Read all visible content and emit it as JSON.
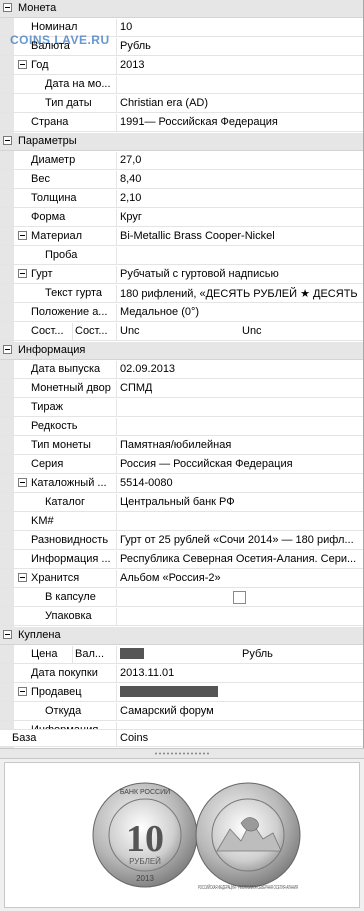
{
  "watermark": "COINS LAVE.RU",
  "categories": {
    "c1": "Монета",
    "c2": "Параметры",
    "c3": "Информация",
    "c4": "Куплена"
  },
  "rows": {
    "nominal": {
      "label": "Номинал",
      "value": "10"
    },
    "currency": {
      "label": "Валюта",
      "value": "Рубль"
    },
    "year": {
      "label": "Год",
      "value": "2013"
    },
    "date_mo": {
      "label": "Дата на мо...",
      "value": ""
    },
    "date_type": {
      "label": "Тип даты",
      "value": "Christian era (AD)"
    },
    "country": {
      "label": "Страна",
      "value": "1991— Российская Федерация"
    },
    "diameter": {
      "label": "Диаметр",
      "value": "27,0"
    },
    "weight": {
      "label": "Вес",
      "value": "8,40"
    },
    "thickness": {
      "label": "Толщина",
      "value": "2,10"
    },
    "shape": {
      "label": "Форма",
      "value": "Круг"
    },
    "material": {
      "label": "Материал",
      "value": "Bi-Metallic Brass Cooper-Nickel"
    },
    "proba": {
      "label": "Проба",
      "value": ""
    },
    "edge": {
      "label": "Гурт",
      "value": "Рубчатый с гуртовой надписью"
    },
    "edge_text": {
      "label": "Текст гурта",
      "value": "180 рифлений, «ДЕСЯТЬ РУБЛЕЙ ★ ДЕСЯТЬ ..."
    },
    "position": {
      "label": "Положение а...",
      "value": "Медальное (0°)"
    },
    "state": {
      "label1": "Сост...",
      "label2": "Сост...",
      "value1": "Unc",
      "value2": "Unc"
    },
    "issue_date": {
      "label": "Дата выпуска",
      "value": "02.09.2013"
    },
    "mint": {
      "label": "Монетный двор",
      "value": "СПМД"
    },
    "mintage": {
      "label": "Тираж",
      "value": ""
    },
    "rarity": {
      "label": "Редкость",
      "value": ""
    },
    "coin_type": {
      "label": "Тип монеты",
      "value": "Памятная/юбилейная"
    },
    "series": {
      "label": "Серия",
      "value": "Россия — Российская Федерация"
    },
    "catalog_no": {
      "label": "Каталожный ...",
      "value": "5514-0080"
    },
    "catalog": {
      "label": "Каталог",
      "value": "Центральный банк РФ"
    },
    "km": {
      "label": "KM#",
      "value": ""
    },
    "variety": {
      "label": "Разновидность",
      "value": "Гурт от 25 рублей «Сочи 2014» — 180 рифл..."
    },
    "info_extra": {
      "label": "Информация ...",
      "value": "Республика Северная Осетия-Алания. Сери..."
    },
    "stored": {
      "label": "Хранится",
      "value": "Альбом «Россия-2»"
    },
    "capsule": {
      "label": "В капсуле",
      "value": ""
    },
    "package": {
      "label": "Упаковка",
      "value": ""
    },
    "price": {
      "label1": "Цена",
      "label2": "Вал...",
      "value": "Рубль"
    },
    "buy_date": {
      "label": "Дата покупки",
      "value": "2013.11.01"
    },
    "seller": {
      "label": "Продавец",
      "value": ""
    },
    "from": {
      "label": "Откуда",
      "value": "Самарский форум"
    },
    "info_buy": {
      "label": "Информация",
      "value": ""
    },
    "base": {
      "label": "База",
      "value": "Coins"
    }
  },
  "coin": {
    "obverse_top": "БАНК РОССИИ",
    "denomination": "10",
    "unit": "РУБЛЕЙ",
    "year": "2013",
    "reverse_ring": "РОССИЙСКАЯ ФЕДЕРАЦИЯ · РЕСПУБЛИКА СЕВЕРНАЯ ОСЕТИЯ-АЛАНИЯ"
  }
}
